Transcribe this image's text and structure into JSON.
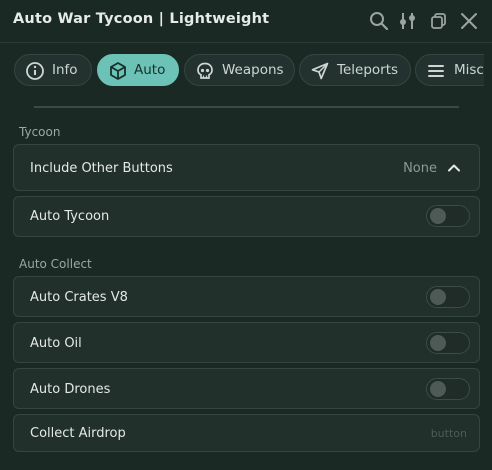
{
  "window": {
    "title": "Auto War Tycoon | Lightweight"
  },
  "titlebar_icons": [
    "search-icon",
    "sliders-icon",
    "copy-icon",
    "close-icon"
  ],
  "tabs": [
    {
      "label": "Info",
      "icon": "info-icon",
      "active": false
    },
    {
      "label": "Auto",
      "icon": "cube-icon",
      "active": true
    },
    {
      "label": "Weapons",
      "icon": "skull-icon",
      "active": false
    },
    {
      "label": "Teleports",
      "icon": "send-icon",
      "active": false
    },
    {
      "label": "Misc",
      "icon": "menu-icon",
      "active": false
    }
  ],
  "sections": {
    "tycoon": {
      "label": "Tycoon",
      "dropdown": {
        "label": "Include Other Buttons",
        "value": "None",
        "expanded": true
      },
      "toggles": [
        {
          "label": "Auto Tycoon",
          "on": false
        }
      ]
    },
    "auto_collect": {
      "label": "Auto Collect",
      "toggles": [
        {
          "label": "Auto Crates V8",
          "on": false
        },
        {
          "label": "Auto Oil",
          "on": false
        },
        {
          "label": "Auto Drones",
          "on": false
        }
      ],
      "button": {
        "label": "Collect Airdrop",
        "hint": "button"
      }
    }
  },
  "colors": {
    "accent": "#6cc2b7",
    "background": "#1b2925",
    "row": "#22302c"
  }
}
